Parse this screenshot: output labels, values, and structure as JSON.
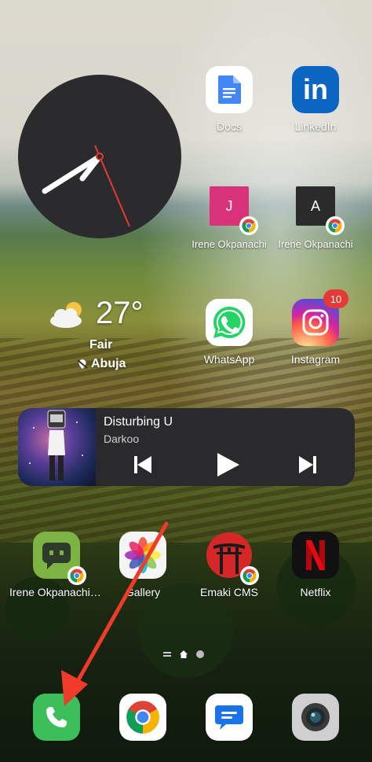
{
  "weather": {
    "temperature": "27°",
    "condition": "Fair",
    "location": "Abuja"
  },
  "apps": {
    "docs": "Docs",
    "linkedin": "LinkedIn",
    "shortcut_j": "Irene Okpanachi",
    "shortcut_j_letter": "J",
    "shortcut_a": "Irene Okpanachi",
    "shortcut_a_letter": "A",
    "whatsapp": "WhatsApp",
    "instagram": "Instagram",
    "instagram_badge": "10",
    "irene_app": "Irene Okpanachi |...",
    "gallery": "Gallery",
    "emaki": "Emaki CMS",
    "netflix": "Netflix"
  },
  "media": {
    "title": "Disturbing U",
    "artist": "Darkoo"
  },
  "colors": {
    "linkedin": "#0a66c2",
    "whatsapp": "#25d366",
    "netflix_red": "#e50914",
    "emaki_red": "#d62728",
    "phone_green": "#34c759",
    "arrow_red": "#f03a2a"
  }
}
